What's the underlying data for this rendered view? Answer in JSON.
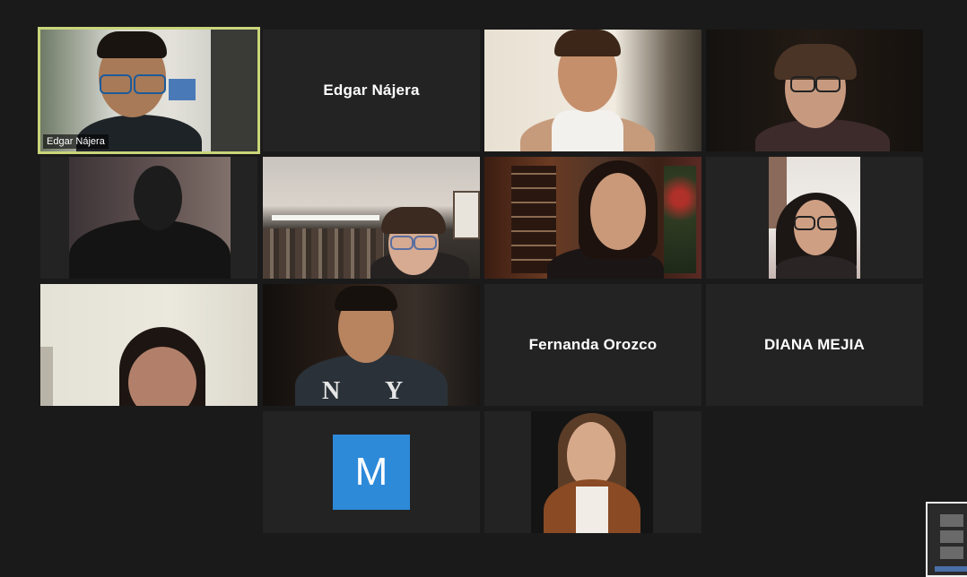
{
  "participants": [
    {
      "name": "Edgar Nájera",
      "mode": "video",
      "active": true
    },
    {
      "name": "Edgar Nájera",
      "mode": "name"
    },
    {
      "name": "",
      "mode": "video"
    },
    {
      "name": "",
      "mode": "video"
    },
    {
      "name": "",
      "mode": "video"
    },
    {
      "name": "",
      "mode": "video"
    },
    {
      "name": "",
      "mode": "video"
    },
    {
      "name": "",
      "mode": "video"
    },
    {
      "name": "",
      "mode": "video"
    },
    {
      "name": "",
      "mode": "video"
    },
    {
      "name": "Fernanda Orozco",
      "mode": "name"
    },
    {
      "name": "DIANA MEJIA",
      "mode": "name"
    },
    {
      "name": "",
      "mode": "avatar",
      "initial": "M",
      "color": "#2d8ad9"
    },
    {
      "name": "",
      "mode": "video"
    }
  ],
  "colors": {
    "background": "#1a1a1a",
    "tile": "#232323",
    "active_speaker_border": "#c9d57a",
    "avatar_blue": "#2d8ad9"
  }
}
